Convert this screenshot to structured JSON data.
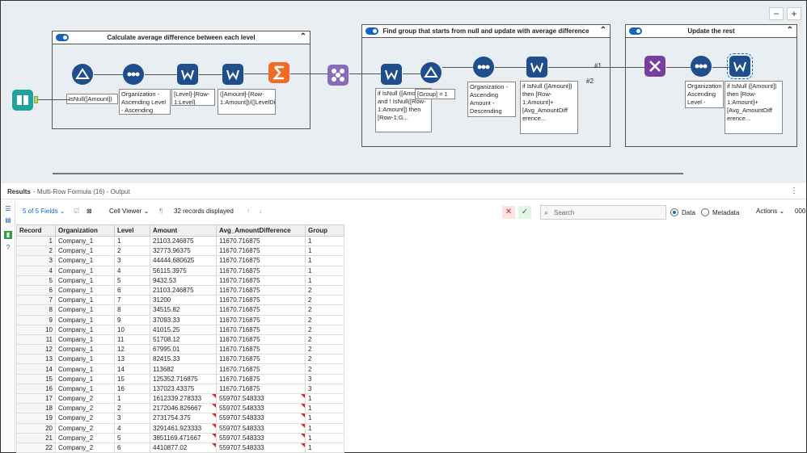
{
  "containers": [
    {
      "title": "Calculate average difference between each level"
    },
    {
      "title": "Find group that starts from null and update with average difference"
    },
    {
      "title": "Update the rest"
    }
  ],
  "annotations": {
    "filter1": "IsNull([Amount])",
    "sort1": "Organization - Ascending Level - Ascending",
    "mr1": "[Level]-[Row-1:Level]",
    "mr2": "([Amount]-[Row-1:Amount])/([LevelDiff])",
    "mr3": "if IsNull ([Amount]) and ! IsNull([Row-1:Amount]) then [Row-1:G...",
    "filter2": "[Group] = 1",
    "sort2": "Organization - Ascending Amount - Descending",
    "mr4": "if IsNull ([Amount]) then [Row-1:Amount]+ [Avg_AmountDiff erence...",
    "sort3": "Organization Ascending Level - Ascend",
    "mr5": "if IsNull ([Amount]) then [Row-1:Amount]+ [Avg_AmountDiff erence...",
    "wire1": "#1",
    "wire2": "#2"
  },
  "icons": [
    "input-book-icon",
    "filter-icon",
    "sort-icon",
    "multi-row-formula-icon",
    "summarize-icon",
    "join-icon",
    "union-icon"
  ],
  "results": {
    "label": "Results",
    "subtitle": "- Multi-Row Formula (16) - Output",
    "fields": "5 of 5 Fields",
    "viewer": "Cell Viewer",
    "records": "32 records displayed",
    "search_placeholder": "Search",
    "data_label": "Data",
    "metadata_label": "Metadata",
    "actions_label": "Actions",
    "actions_extra": "000"
  },
  "table": {
    "columns": [
      "Record",
      "Organization",
      "Level",
      "Amount",
      "Avg_AmountDifference",
      "Group"
    ],
    "rows": [
      [
        "1",
        "Company_1",
        "1",
        "21103.246875",
        "11670.716875",
        "1"
      ],
      [
        "2",
        "Company_1",
        "2",
        "32773.96375",
        "11670.716875",
        "1"
      ],
      [
        "3",
        "Company_1",
        "3",
        "44444.680625",
        "11670.716875",
        "1"
      ],
      [
        "4",
        "Company_1",
        "4",
        "56115.3975",
        "11670.716875",
        "1"
      ],
      [
        "5",
        "Company_1",
        "5",
        "9432.53",
        "11670.716875",
        "1"
      ],
      [
        "6",
        "Company_1",
        "6",
        "21103.246875",
        "11670.716875",
        "2"
      ],
      [
        "7",
        "Company_1",
        "7",
        "31200",
        "11670.716875",
        "2"
      ],
      [
        "8",
        "Company_1",
        "8",
        "34515.82",
        "11670.716875",
        "2"
      ],
      [
        "9",
        "Company_1",
        "9",
        "37093.33",
        "11670.716875",
        "2"
      ],
      [
        "10",
        "Company_1",
        "10",
        "41015.25",
        "11670.716875",
        "2"
      ],
      [
        "11",
        "Company_1",
        "11",
        "51708.12",
        "11670.716875",
        "2"
      ],
      [
        "12",
        "Company_1",
        "12",
        "67995.01",
        "11670.716875",
        "2"
      ],
      [
        "13",
        "Company_1",
        "13",
        "82415.33",
        "11670.716875",
        "2"
      ],
      [
        "14",
        "Company_1",
        "14",
        "113682",
        "11670.716875",
        "2"
      ],
      [
        "15",
        "Company_1",
        "15",
        "125352.716875",
        "11670.716875",
        "3"
      ],
      [
        "16",
        "Company_1",
        "16",
        "137023.43375",
        "11670.716875",
        "3"
      ],
      [
        "17",
        "Company_2",
        "1",
        "1612339.278333",
        "559707.548333",
        "1"
      ],
      [
        "18",
        "Company_2",
        "2",
        "2172046.826667",
        "559707.548333",
        "1"
      ],
      [
        "19",
        "Company_2",
        "3",
        "2731754.375",
        "559707.548333",
        "1"
      ],
      [
        "20",
        "Company_2",
        "4",
        "3291461.923333",
        "559707.548333",
        "1"
      ],
      [
        "21",
        "Company_2",
        "5",
        "3851169.471667",
        "559707.548333",
        "1"
      ],
      [
        "22",
        "Company_2",
        "6",
        "4410877.02",
        "559707.548333",
        "1"
      ]
    ]
  }
}
